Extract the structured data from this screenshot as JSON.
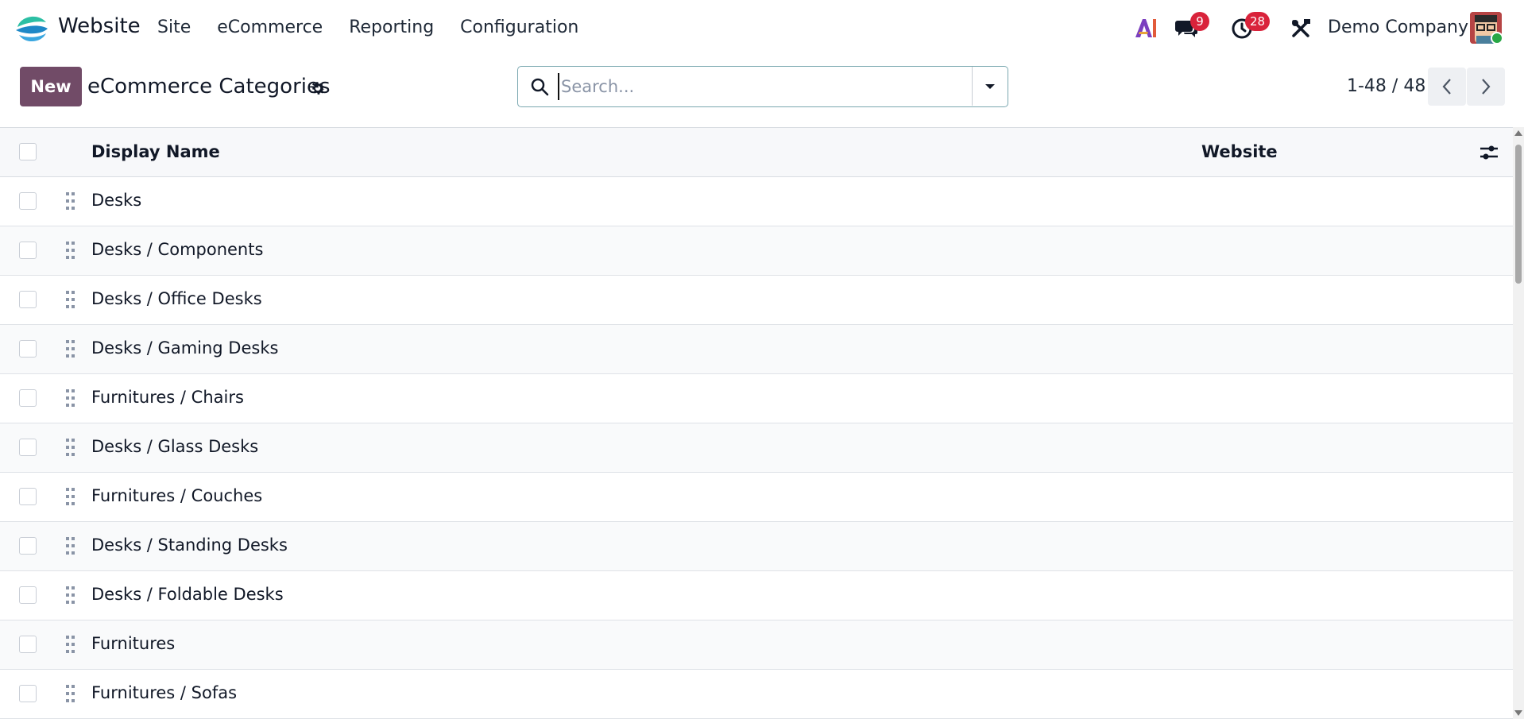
{
  "navbar": {
    "app_name": "Website",
    "menu": [
      {
        "label": "Site"
      },
      {
        "label": "eCommerce"
      },
      {
        "label": "Reporting"
      },
      {
        "label": "Configuration"
      }
    ],
    "icons": [
      "app-logo-icon",
      "ai-icon",
      "chat-icon",
      "activity-clock-icon",
      "tools-icon"
    ],
    "messages_badge": "9",
    "activities_badge": "28",
    "company": "Demo Company",
    "colors": {
      "brand": "#714b67",
      "badge": "#d9233b",
      "online": "#28a745"
    }
  },
  "control_panel": {
    "new_label": "New",
    "title": "eCommerce Categories",
    "search_placeholder": "Search...",
    "search_value": "",
    "pager": "1-48 / 48"
  },
  "list": {
    "columns": [
      "Display Name",
      "Website"
    ],
    "rows": [
      {
        "name": "Desks",
        "website": ""
      },
      {
        "name": "Desks / Components",
        "website": ""
      },
      {
        "name": "Desks / Office Desks",
        "website": ""
      },
      {
        "name": "Desks / Gaming Desks",
        "website": ""
      },
      {
        "name": "Furnitures / Chairs",
        "website": ""
      },
      {
        "name": "Desks / Glass Desks",
        "website": ""
      },
      {
        "name": "Furnitures / Couches",
        "website": ""
      },
      {
        "name": "Desks / Standing Desks",
        "website": ""
      },
      {
        "name": "Desks / Foldable Desks",
        "website": ""
      },
      {
        "name": "Furnitures",
        "website": ""
      },
      {
        "name": "Furnitures / Sofas",
        "website": ""
      }
    ]
  }
}
